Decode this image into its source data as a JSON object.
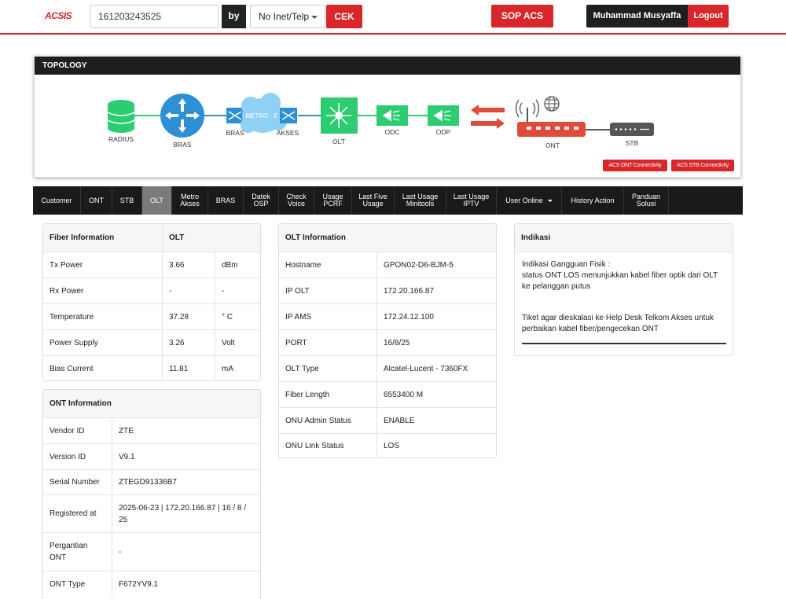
{
  "header": {
    "logo": "ACSIS",
    "search_value": "161203243525",
    "by_label": "by",
    "select_value": "No Inet/Telp",
    "cek_label": "CEK",
    "sop_label": "SOP ACS",
    "user_name": "Muhammad Musyaffa",
    "logout_label": "Logout"
  },
  "topology": {
    "title": "TOPOLOGY",
    "nodes": {
      "radius": "RADIUS",
      "bras": "BRAS",
      "bras2": "BRAS",
      "metro": "METRO - E",
      "akses": "AKSES",
      "olt": "OLT",
      "odc": "ODC",
      "odp": "ODP",
      "ont": "ONT",
      "stb": "STB"
    },
    "acs_ont_label": "ACS ONT Connectivity",
    "acs_stb_label": "ACS STB Connectivity",
    "colors": {
      "green": "#2ecc71",
      "blue": "#2d8fd5",
      "red": "#e24a3b",
      "gray": "#555555",
      "cloud": "#8fd0f5"
    }
  },
  "tabs": [
    {
      "label": "Customer"
    },
    {
      "label": "ONT"
    },
    {
      "label": "STB"
    },
    {
      "label": "OLT",
      "active": true
    },
    {
      "label": "Metro\nAkses"
    },
    {
      "label": "BRAS"
    },
    {
      "label": "Datek\nOSP"
    },
    {
      "label": "Check\nVoice"
    },
    {
      "label": "Usage\nPCRF"
    },
    {
      "label": "Last Five\nUsage"
    },
    {
      "label": "Last Usage\nMinitools"
    },
    {
      "label": "Last Usage\nIPTV"
    },
    {
      "label": "User Online",
      "dropdown": true
    },
    {
      "label": "History Action"
    },
    {
      "label": "Panduan\nSolusi"
    }
  ],
  "fiber": {
    "title": "Fiber Information",
    "col2": "OLT",
    "rows": [
      {
        "label": "Tx Power",
        "value": "3.66",
        "unit": "dBm"
      },
      {
        "label": "Rx Power",
        "value": "-",
        "unit": "-"
      },
      {
        "label": "Temperature",
        "value": "37.28",
        "unit": "° C"
      },
      {
        "label": "Power Supply",
        "value": "3.26",
        "unit": "Volt"
      },
      {
        "label": "Bias Current",
        "value": "11.81",
        "unit": "mA"
      }
    ]
  },
  "ont_info": {
    "title": "ONT Information",
    "rows": [
      {
        "label": "Vendor ID",
        "value": "ZTE"
      },
      {
        "label": "Version ID",
        "value": "V9.1"
      },
      {
        "label": "Serial Number",
        "value": "ZTEGD91336B7"
      },
      {
        "label": "Registered at",
        "value": "2025-06-23 | 172.20.166.87 | 16 / 8 / 25"
      },
      {
        "label": "Pergantian ONT",
        "value": "-"
      },
      {
        "label": "ONT Type",
        "value": "F672YV9.1"
      }
    ]
  },
  "olt_info": {
    "title": "OLT Information",
    "rows": [
      {
        "label": "Hostname",
        "value": "GPON02-D6-BJM-5"
      },
      {
        "label": "IP OLT",
        "value": "172.20.166.87"
      },
      {
        "label": "IP AMS",
        "value": "172.24.12.100"
      },
      {
        "label": "PORT",
        "value": "16/8/25"
      },
      {
        "label": "OLT Type",
        "value": "Alcatel-Lucent - 7360FX"
      },
      {
        "label": "Fiber Length",
        "value": "6553400 M"
      },
      {
        "label": "ONU Admin Status",
        "value": "ENABLE"
      },
      {
        "label": "ONU Link Status",
        "value": "LOS"
      }
    ]
  },
  "indikasi": {
    "title": "Indikasi",
    "heading": "Indikasi Gangguan Fisik :",
    "line1": "status ONT LOS menunjukkan kabel fiber optik dari OLT ke pelanggan putus",
    "line2": "Tiket agar dieskalasi ke Help Desk Telkom Akses untuk perbaikan kabel fiber/pengecekan ONT"
  }
}
